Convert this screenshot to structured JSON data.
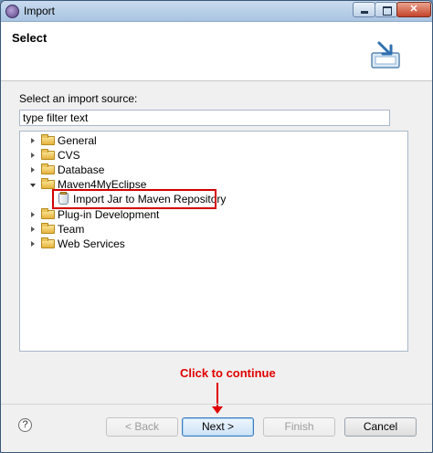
{
  "window": {
    "title": "Import",
    "controls": {
      "minimize": "minimize-icon",
      "maximize": "maximize-icon",
      "close": "close-icon"
    },
    "close_glyph": "✕"
  },
  "header": {
    "title": "Select",
    "icon": "import-wizard-icon"
  },
  "source": {
    "label": "Select an import source:",
    "filter_value": "type filter text"
  },
  "tree": {
    "items": [
      {
        "label": "General",
        "expanded": false,
        "level": 0,
        "icon": "folder-icon"
      },
      {
        "label": "CVS",
        "expanded": false,
        "level": 0,
        "icon": "folder-icon"
      },
      {
        "label": "Database",
        "expanded": false,
        "level": 0,
        "icon": "folder-icon"
      },
      {
        "label": "Maven4MyEclipse",
        "expanded": true,
        "level": 0,
        "icon": "folder-open-icon"
      },
      {
        "label": "Import Jar to Maven Repository",
        "level": 1,
        "icon": "jar-icon",
        "highlighted": true
      },
      {
        "label": "Plug-in Development",
        "expanded": false,
        "level": 0,
        "icon": "folder-icon"
      },
      {
        "label": "Team",
        "expanded": false,
        "level": 0,
        "icon": "folder-icon"
      },
      {
        "label": "Web Services",
        "expanded": false,
        "level": 0,
        "icon": "folder-icon"
      }
    ]
  },
  "annotation": {
    "text": "Click to continue",
    "color": "#e00000"
  },
  "footer": {
    "help_glyph": "?",
    "buttons": {
      "back": {
        "label": "< Back",
        "enabled": false
      },
      "next": {
        "label": "Next >",
        "enabled": true,
        "default": true
      },
      "finish": {
        "label": "Finish",
        "enabled": false
      },
      "cancel": {
        "label": "Cancel",
        "enabled": true
      }
    }
  }
}
